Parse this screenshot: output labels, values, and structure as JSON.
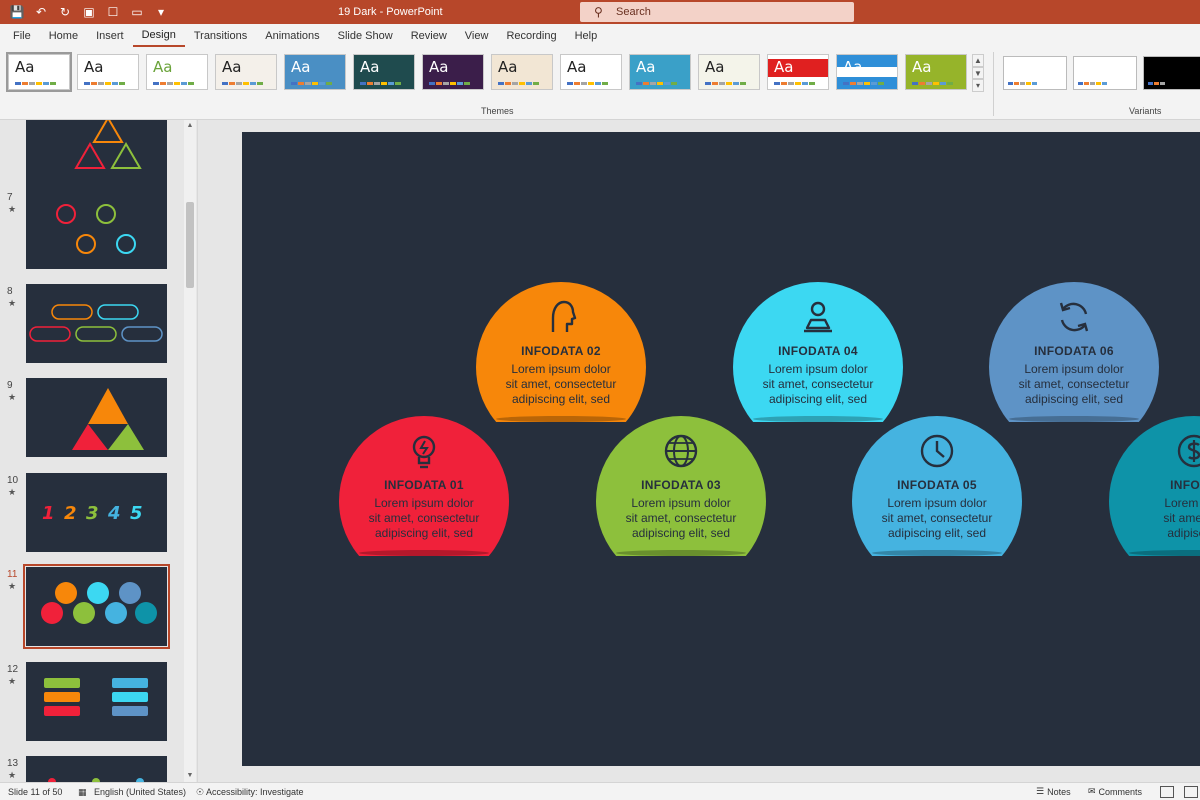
{
  "titlebar": {
    "doc_title": "19 Dark  -  PowerPoint",
    "search_placeholder": "Search",
    "accent": "#b7472a"
  },
  "tabs": [
    "File",
    "Home",
    "Insert",
    "Design",
    "Transitions",
    "Animations",
    "Slide Show",
    "Review",
    "View",
    "Recording",
    "Help"
  ],
  "active_tab": "Design",
  "ribbon": {
    "themes_label": "Themes",
    "variants_label": "Variants",
    "themes": [
      {
        "label": "Aa",
        "bg": "#ffffff",
        "fg": "#222222"
      },
      {
        "label": "Aa",
        "bg": "#ffffff",
        "fg": "#222222"
      },
      {
        "label": "Aa",
        "bg": "#ffffff",
        "fg": "#6aa33a"
      },
      {
        "label": "Aa",
        "bg": "#f4f0ea",
        "fg": "#222222"
      },
      {
        "label": "Aa",
        "bg": "#4a8fc4",
        "fg": "#ffffff"
      },
      {
        "label": "Aa",
        "bg": "#1f4b4e",
        "fg": "#ffffff"
      },
      {
        "label": "Aa",
        "bg": "#3b1e4a",
        "fg": "#ffffff"
      },
      {
        "label": "Aa",
        "bg": "#f2e6d4",
        "fg": "#222222"
      },
      {
        "label": "Aa",
        "bg": "#ffffff",
        "fg": "#222222"
      },
      {
        "label": "Aa",
        "bg": "#3aa0c8",
        "fg": "#ffffff"
      },
      {
        "label": "Aa",
        "bg": "#f4f4ea",
        "fg": "#222222"
      },
      {
        "label": "Aa",
        "bg": "#ffffff",
        "fg": "#ffffff"
      },
      {
        "label": "Aa",
        "bg": "#2f8fd8",
        "fg": "#ffffff"
      },
      {
        "label": "Aa",
        "bg": "#96b42a",
        "fg": "#ffffff"
      }
    ]
  },
  "slides": [
    {
      "num": "",
      "star": ""
    },
    {
      "num": "7",
      "star": "★"
    },
    {
      "num": "8",
      "star": "★"
    },
    {
      "num": "9",
      "star": "★"
    },
    {
      "num": "10",
      "star": "★"
    },
    {
      "num": "11",
      "star": "★"
    },
    {
      "num": "12",
      "star": "★"
    },
    {
      "num": "13",
      "star": "★"
    }
  ],
  "selected_slide": "11",
  "infographic": {
    "cards": [
      {
        "title": "INFODATA 01",
        "body": [
          "Lorem ipsum dolor",
          "sit amet, consectetur",
          "adipiscing elit, sed"
        ],
        "color": "#f0213a",
        "icon": "lightbulb-icon"
      },
      {
        "title": "INFODATA 02",
        "body": [
          "Lorem ipsum dolor",
          "sit amet, consectetur",
          "adipiscing elit, sed"
        ],
        "color": "#f7870a",
        "icon": "head-profile-icon"
      },
      {
        "title": "INFODATA 03",
        "body": [
          "Lorem ipsum dolor",
          "sit amet, consectetur",
          "adipiscing elit, sed"
        ],
        "color": "#8dc03c",
        "icon": "globe-icon"
      },
      {
        "title": "INFODATA 04",
        "body": [
          "Lorem ipsum dolor",
          "sit amet, consectetur",
          "adipiscing elit, sed"
        ],
        "color": "#3cd8f2",
        "icon": "user-desk-icon"
      },
      {
        "title": "INFODATA 05",
        "body": [
          "Lorem ipsum dolor",
          "sit amet, consectetur",
          "adipiscing elit, sed"
        ],
        "color": "#45b3e0",
        "icon": "clock-icon"
      },
      {
        "title": "INFODATA 06",
        "body": [
          "Lorem ipsum dolor",
          "sit amet, consectetur",
          "adipiscing elit, sed"
        ],
        "color": "#5e93c6",
        "icon": "refresh-icon"
      },
      {
        "title": "INFODA",
        "body": [
          "Lorem ipsu",
          "sit amet, co",
          "adipiscing"
        ],
        "color": "#0e93a8",
        "icon": "dollar-icon"
      }
    ]
  },
  "statusbar": {
    "slide_of": "Slide 11 of 50",
    "language": "English (United States)",
    "accessibility": "Accessibility: Investigate",
    "notes": "Notes",
    "comments": "Comments"
  }
}
